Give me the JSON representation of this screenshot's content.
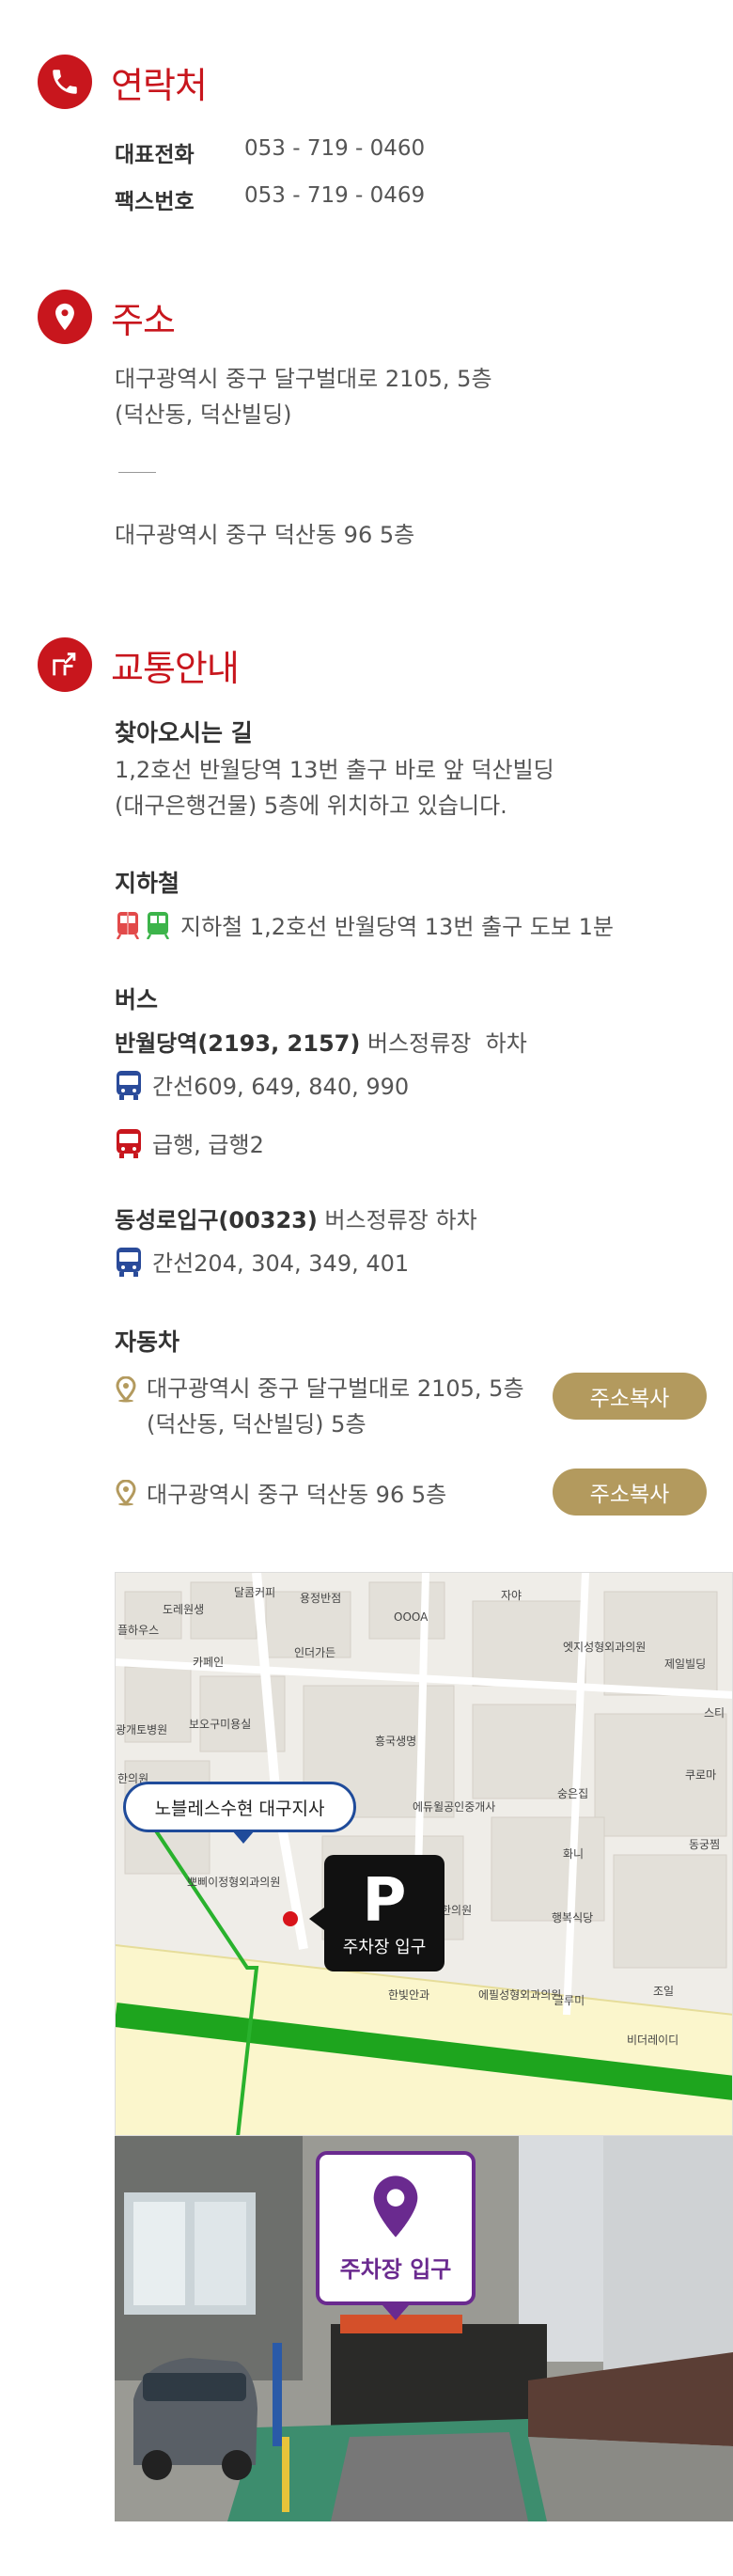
{
  "contact": {
    "title": "연락처",
    "rows": [
      {
        "label": "대표전화",
        "value": "053 - 719 - 0460"
      },
      {
        "label": "팩스번호",
        "value": "053 - 719 - 0469"
      }
    ]
  },
  "address": {
    "title": "주소",
    "road_line1": "대구광역시 중구 달구벌대로 2105, 5층",
    "road_line2": "(덕산동, 덕산빌딩)",
    "lot": "대구광역시 중구 덕산동 96 5층"
  },
  "transport": {
    "title": "교통안내",
    "directions": {
      "heading": "찾아오시는 길",
      "line1": "1,2호선 반월당역 13번 출구 바로 앞 덕산빌딩",
      "line2": "(대구은행건물) 5층에 위치하고 있습니다."
    },
    "subway": {
      "heading": "지하철",
      "text": "지하철 1,2호선 반월당역 13번 출구 도보 1분",
      "colors": [
        "#e24a4a",
        "#3cb44a"
      ]
    },
    "bus": {
      "heading": "버스",
      "stop1_bold": "반월당역(2193, 2157)",
      "stop1_rest": " 버스정류장  하차",
      "stop1_trunk": "간선609, 649, 840, 990",
      "stop1_express": "급행, 급행2",
      "stop2_bold": "동성로입구(00323)",
      "stop2_rest": " 버스정류장 하차",
      "stop2_trunk": "간선204, 304, 349, 401",
      "colors": {
        "trunk": "#2a4b9a",
        "express": "#c8161d"
      }
    },
    "car": {
      "heading": "자동차",
      "addr1_line1": "대구광역시 중구 달구벌대로 2105, 5층",
      "addr1_line2": "(덕산동, 덕산빌딩) 5층",
      "addr2": "대구광역시 중구 덕산동 96 5층",
      "copy_label": "주소복사"
    }
  },
  "map": {
    "office_label": "노블레스수현 대구지사",
    "parking_letter": "P",
    "parking_label": "주차장 입구",
    "labels": [
      "도레원생",
      "달콤커피",
      "용정반점",
      "자야",
      "플하우스",
      "OOOA",
      "카페인",
      "인더가든",
      "엣지성형외과의원",
      "제일빌딩",
      "보오구미용실",
      "광개토병원",
      "흥국생명",
      "한의원",
      "숭은집",
      "쿠로마",
      "에듀윌공인중개사",
      "뽀삐이정형외과의원",
      "한의원",
      "화니",
      "동궁찜",
      "행복식당",
      "한빛안과",
      "에필성형외과의원",
      "글루미",
      "조일",
      "비더레이디",
      "스티"
    ]
  },
  "photo": {
    "parking_label": "주차장 입구",
    "accent": "#6a2a8f"
  }
}
